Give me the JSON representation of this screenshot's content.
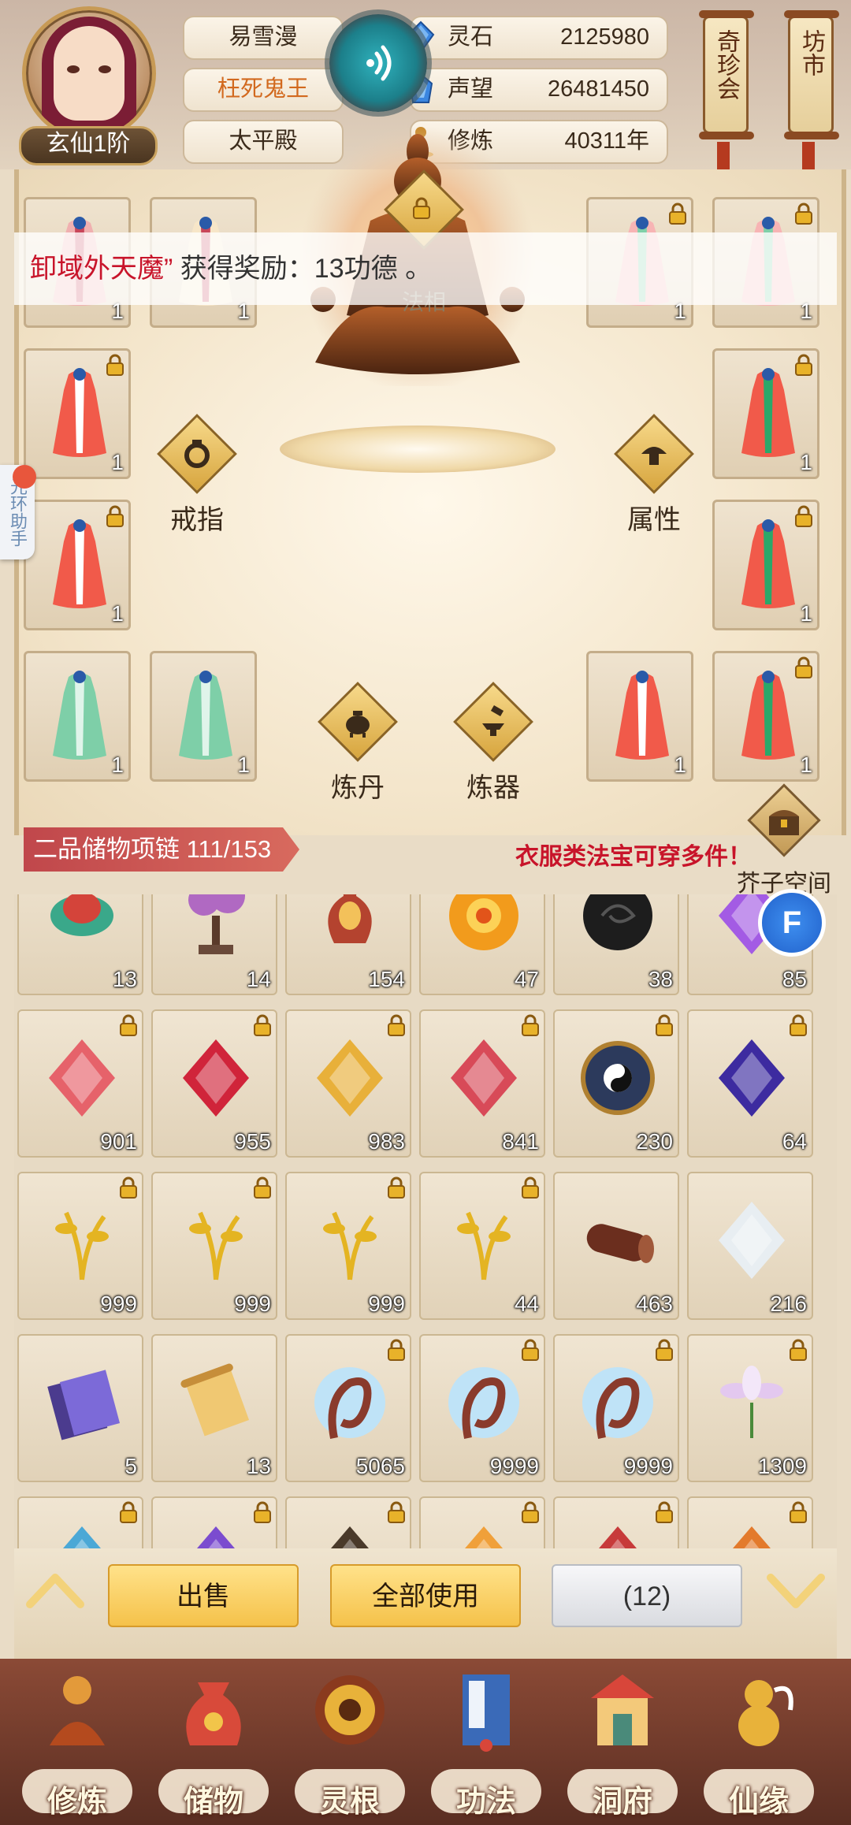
{
  "profile": {
    "rank": "玄仙1阶",
    "name": "易雪漫",
    "title": "枉死鬼王",
    "location": "太平殿"
  },
  "stats": [
    {
      "label": "灵石",
      "value": "2125980",
      "icon": "spirit-stone-icon",
      "color": "#3b86e0"
    },
    {
      "label": "声望",
      "value": "26481450",
      "icon": "crystal-icon",
      "color": "#3b86e0"
    },
    {
      "label": "修炼",
      "value": "40311年",
      "icon": "meditation-icon",
      "color": "#c8892c"
    }
  ],
  "scrolls": {
    "left": "奇珍会",
    "right": "坊市"
  },
  "toast": {
    "part1": "卸域外天魔”",
    "part2": "获得奖励：13功德",
    "part3": "。"
  },
  "equipment": {
    "top_center_label": "法相",
    "functions": [
      "戒指",
      "属性",
      "炼丹",
      "炼器"
    ],
    "slots_left": [
      {
        "count": "1",
        "locked": false
      },
      {
        "count": "1",
        "locked": false
      },
      {
        "count": "1",
        "locked": true
      },
      {
        "count": "1",
        "locked": true
      },
      {
        "count": "1",
        "locked": false
      },
      {
        "count": "1",
        "locked": false
      }
    ],
    "slots_right": [
      {
        "count": "1",
        "locked": true
      },
      {
        "count": "1",
        "locked": true
      },
      {
        "count": "1",
        "locked": true
      },
      {
        "count": "1",
        "locked": true
      },
      {
        "count": "1",
        "locked": false
      },
      {
        "count": "1",
        "locked": true
      }
    ]
  },
  "side_tab": {
    "text": "光环助手"
  },
  "storage": {
    "header": "二品储物项链 111/153",
    "tip": "衣服类法宝可穿多件！",
    "space_button": "芥子空间"
  },
  "inventory": [
    {
      "count": "13",
      "locked": false,
      "icon": "koi-fish-icon",
      "color": "#d4443a"
    },
    {
      "count": "14",
      "locked": false,
      "icon": "bonsai-tree-icon",
      "color": "#b069c2"
    },
    {
      "count": "154",
      "locked": false,
      "icon": "vase-icon",
      "color": "#b4432f"
    },
    {
      "count": "47",
      "locked": false,
      "icon": "fire-orb-icon",
      "color": "#f29b1c"
    },
    {
      "count": "38",
      "locked": false,
      "icon": "black-stone-icon",
      "color": "#1d1d1d"
    },
    {
      "count": "85",
      "locked": false,
      "icon": "purple-crystal-icon",
      "color": "#a35be4"
    },
    {
      "count": "901",
      "locked": true,
      "icon": "peach-icon",
      "color": "#e6626a"
    },
    {
      "count": "955",
      "locked": true,
      "icon": "raspberry-icon",
      "color": "#d0243a"
    },
    {
      "count": "983",
      "locked": true,
      "icon": "lotus-fruit-icon",
      "color": "#e8b03a"
    },
    {
      "count": "841",
      "locked": true,
      "icon": "pomegranate-icon",
      "color": "#d84a58"
    },
    {
      "count": "230",
      "locked": true,
      "icon": "bagua-compass-icon",
      "color": "#2c3a5c"
    },
    {
      "count": "64",
      "locked": true,
      "icon": "void-crystal-icon",
      "color": "#3d2ba0"
    },
    {
      "count": "999",
      "locked": true,
      "icon": "golden-grass-icon",
      "color": "#e4b422"
    },
    {
      "count": "999",
      "locked": true,
      "icon": "golden-grass-icon",
      "color": "#e4b422"
    },
    {
      "count": "999",
      "locked": true,
      "icon": "golden-grass-icon",
      "color": "#e4b422"
    },
    {
      "count": "44",
      "locked": true,
      "icon": "golden-grass-icon",
      "color": "#e4b422"
    },
    {
      "count": "463",
      "locked": false,
      "icon": "wood-log-icon",
      "color": "#6b2e1e"
    },
    {
      "count": "216",
      "locked": false,
      "icon": "white-crystal-icon",
      "color": "#e8eef2"
    },
    {
      "count": "5",
      "locked": false,
      "icon": "talisman-icon",
      "color": "#4b3b8e"
    },
    {
      "count": "13",
      "locked": false,
      "icon": "scroll-icon",
      "color": "#f0c872"
    },
    {
      "count": "5065",
      "locked": true,
      "icon": "dragon-herb-icon",
      "color": "#8a3b2c"
    },
    {
      "count": "9999",
      "locked": true,
      "icon": "dragon-herb-icon",
      "color": "#8a3b2c"
    },
    {
      "count": "9999",
      "locked": true,
      "icon": "dragon-herb-icon",
      "color": "#8a3b2c"
    },
    {
      "count": "1309",
      "locked": true,
      "icon": "lily-flower-icon",
      "color": "#e3c8ef"
    },
    {
      "count": "",
      "locked": true,
      "icon": "blue-item-icon",
      "color": "#4ba8d6"
    },
    {
      "count": "",
      "locked": true,
      "icon": "purple-item-icon",
      "color": "#7b4ccf"
    },
    {
      "count": "",
      "locked": true,
      "icon": "dark-item-icon",
      "color": "#4a3a2a"
    },
    {
      "count": "",
      "locked": true,
      "icon": "orange-item-icon",
      "color": "#f0a03a"
    },
    {
      "count": "",
      "locked": true,
      "icon": "red-item-icon",
      "color": "#c73a3a"
    },
    {
      "count": "",
      "locked": true,
      "icon": "orange-item-icon",
      "color": "#e37a2c"
    }
  ],
  "actions": {
    "sell": "出售",
    "use_all": "全部使用",
    "count": "(12)"
  },
  "nav": [
    {
      "label": "修炼",
      "icon": "meditation-monk-icon"
    },
    {
      "label": "储物",
      "icon": "treasure-bag-icon"
    },
    {
      "label": "灵根",
      "icon": "spirit-root-icon"
    },
    {
      "label": "功法",
      "icon": "manual-book-icon"
    },
    {
      "label": "洞府",
      "icon": "cave-palace-icon"
    },
    {
      "label": "仙缘",
      "icon": "gourd-icon"
    }
  ]
}
